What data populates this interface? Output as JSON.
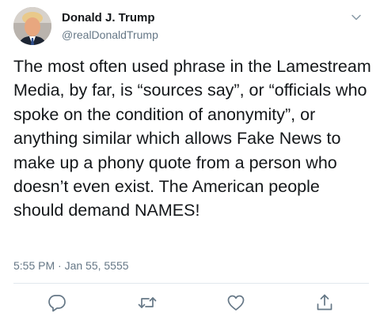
{
  "tweet": {
    "display_name": "Donald J. Trump",
    "handle": "@realDonaldTrump",
    "text": "The most often used phrase in the Lamestream Media, by far, is “sources say”, or “officials who spoke on the condition of anonymity”, or anything similar which allows Fake News to make up a phony quote from a person who doesn’t even exist. The American people should demand NAMES!",
    "timestamp": "5:55 PM · Jan 55, 5555"
  },
  "icons": {
    "menu": "chevron-down-icon",
    "avatar": "profile-photo",
    "reply": "reply-icon",
    "retweet": "retweet-icon",
    "like": "heart-icon",
    "share": "share-icon"
  },
  "colors": {
    "text": "#14171a",
    "secondary": "#657786",
    "icon": "#657786",
    "divider": "#e1e8ed"
  }
}
